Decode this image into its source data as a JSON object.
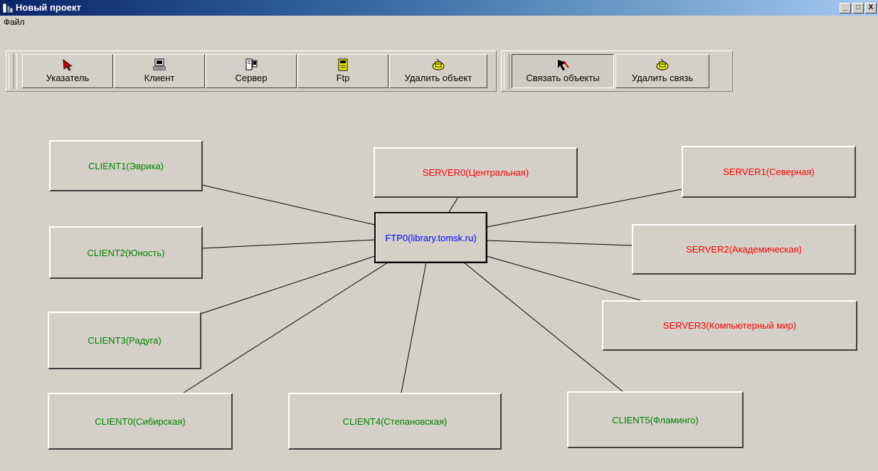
{
  "window": {
    "title": "Новый проект",
    "controls": {
      "minimize": "_",
      "maximize": "□",
      "close": "X"
    }
  },
  "menu": {
    "file": "Файл"
  },
  "toolbar_main": {
    "buttons": [
      {
        "label": "Указатель",
        "icon": "pointer-arrow-icon"
      },
      {
        "label": "Клиент",
        "icon": "client-computer-icon"
      },
      {
        "label": "Сервер",
        "icon": "server-icon"
      },
      {
        "label": "Ftp",
        "icon": "ftp-icon"
      },
      {
        "label": "Удалить объект",
        "icon": "delete-object-icon"
      }
    ]
  },
  "toolbar_links": {
    "buttons": [
      {
        "label": "Связать объекты",
        "icon": "link-objects-icon",
        "pressed": true
      },
      {
        "label": "Удалить связь",
        "icon": "delete-link-icon"
      }
    ]
  },
  "diagram": {
    "ftp": {
      "label": "FTP0(library.tomsk.ru)"
    },
    "clients": [
      {
        "label": "CLIENT1(Эврика)"
      },
      {
        "label": "CLIENT2(Юность)"
      },
      {
        "label": "CLIENT3(Радуга)"
      },
      {
        "label": "CLIENT0(Сибирская)"
      },
      {
        "label": "CLIENT4(Степановская)"
      },
      {
        "label": "CLIENT5(Фламинго)"
      }
    ],
    "servers": [
      {
        "label": "SERVER0(Центральная)"
      },
      {
        "label": "SERVER1(Северная)"
      },
      {
        "label": "SERVER2(Академическая)"
      },
      {
        "label": "SERVER3(Компьютерный мир)"
      }
    ]
  },
  "colors": {
    "client_text": "#008000",
    "server_text": "#ff0000",
    "ftp_text": "#0000ff"
  }
}
